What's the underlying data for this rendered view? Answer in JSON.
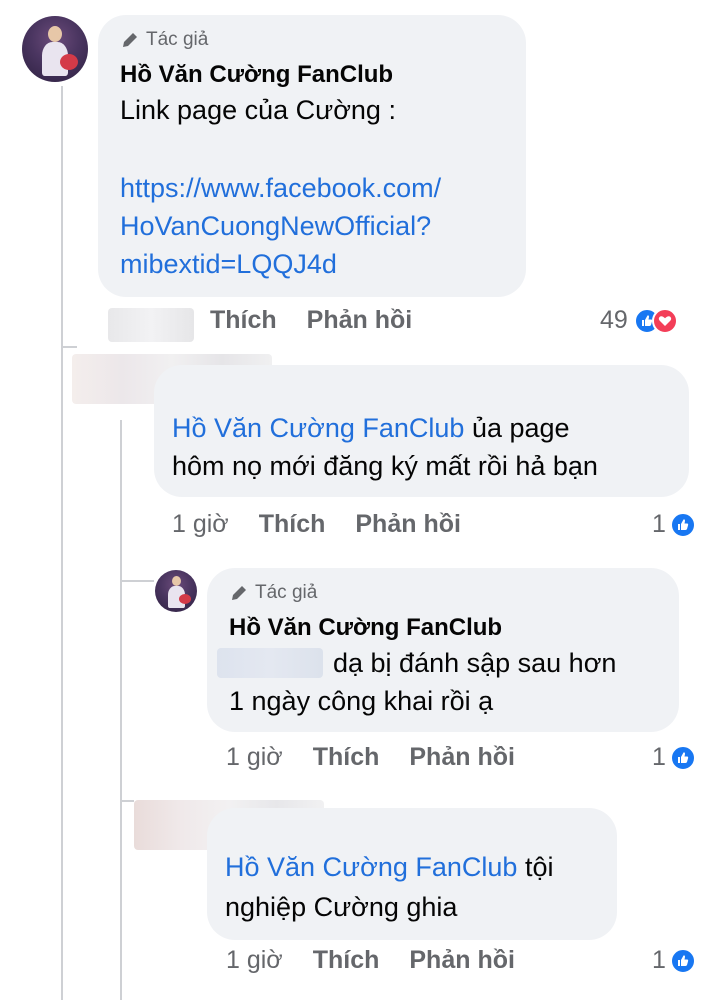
{
  "colors": {
    "link": "#216fdb",
    "bubble": "#f0f2f5",
    "muted": "#65676b",
    "like": "#1877f2",
    "love": "#f33e58"
  },
  "comments": [
    {
      "author_badge": "Tác giả",
      "author": "Hồ Văn Cường FanClub",
      "text": "Link page của Cường :",
      "link_lines": [
        "https://www.facebook.com/",
        "HoVanCuongNewOfficial?",
        "mibextid=LQQJ4d"
      ],
      "actions": {
        "like": "Thích",
        "reply": "Phản hồi"
      },
      "reaction_count": "49",
      "reaction_icons": [
        "like-icon",
        "love-icon"
      ]
    },
    {
      "mention": "Hồ Văn Cường FanClub",
      "text_line1": " ủa page",
      "text_line2": "hôm nọ mới đăng ký mất rồi hả bạn",
      "time": "1 giờ",
      "actions": {
        "like": "Thích",
        "reply": "Phản hồi"
      },
      "reaction_count": "1",
      "reaction_icons": [
        "like-icon"
      ]
    },
    {
      "author_badge": "Tác giả",
      "author": "Hồ Văn Cường FanClub",
      "text_line1": "dạ bị đánh sập sau hơn",
      "text_line2": "1 ngày công khai rồi ạ",
      "time": "1 giờ",
      "actions": {
        "like": "Thích",
        "reply": "Phản hồi"
      },
      "reaction_count": "1",
      "reaction_icons": [
        "like-icon"
      ]
    },
    {
      "mention": "Hồ Văn Cường FanClub",
      "text_line1": " tội",
      "text_line2": "nghiệp Cường ghia",
      "time": "1 giờ",
      "actions": {
        "like": "Thích",
        "reply": "Phản hồi"
      },
      "reaction_count": "1",
      "reaction_icons": [
        "like-icon"
      ]
    }
  ]
}
